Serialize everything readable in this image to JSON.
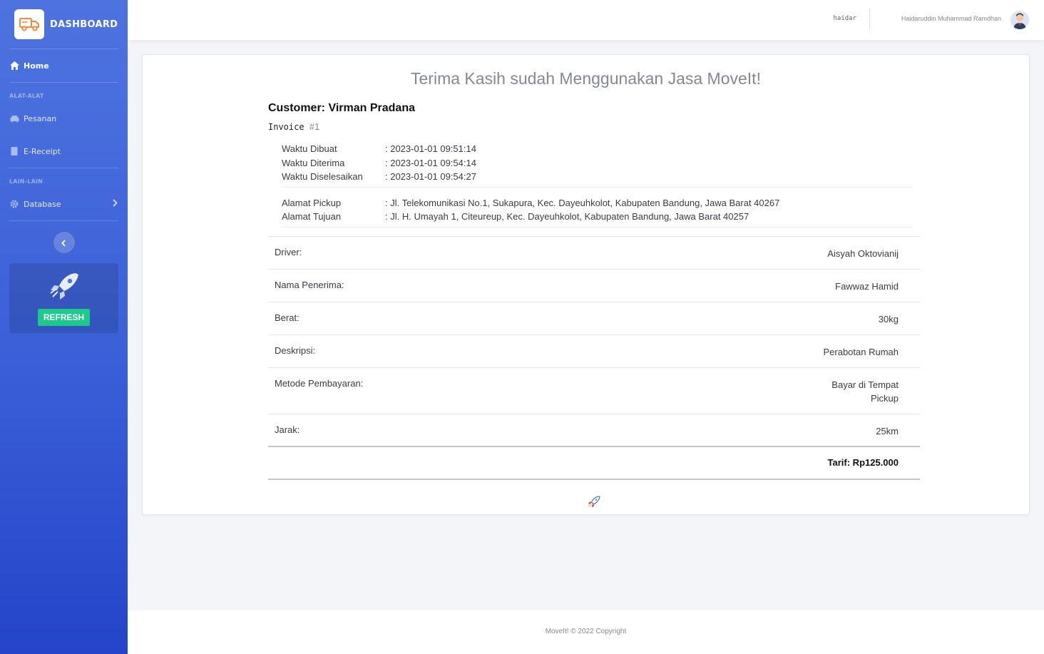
{
  "sidebar": {
    "brand": "DASHBOARD",
    "home": "Home",
    "heading_tools": "ALAT-ALAT",
    "pesanan": "Pesanan",
    "ereceipt": "E-Receipt",
    "heading_other": "LAIN-LAIN",
    "database": "Database",
    "refresh": "REFRESH"
  },
  "topbar": {
    "username": "haidar",
    "fullname": "Haidaruddin Muhammad Ramdhan"
  },
  "receipt": {
    "title": "Terima Kasih sudah Menggunakan Jasa MoveIt!",
    "customer": "Customer: Virman Pradana",
    "invoice_label": "Invoice",
    "invoice_num": "#1",
    "times": [
      {
        "label": "Waktu Dibuat",
        "value": ": 2023-01-01 09:51:14"
      },
      {
        "label": "Waktu Diterima",
        "value": ": 2023-01-01 09:54:14"
      },
      {
        "label": "Waktu Diselesaikan",
        "value": ": 2023-01-01 09:54:27"
      }
    ],
    "addresses": [
      {
        "label": "Alamat Pickup",
        "value": ": Jl. Telekomunikasi No.1, Sukapura, Kec. Dayeuhkolot, Kabupaten Bandung, Jawa Barat 40267"
      },
      {
        "label": "Alamat Tujuan",
        "value": ": Jl. H. Umayah 1, Citeureup, Kec. Dayeuhkolot, Kabupaten Bandung, Jawa Barat 40257"
      }
    ],
    "details": [
      {
        "label": "Driver:",
        "value": "Aisyah Oktovianij"
      },
      {
        "label": "Nama Penerima:",
        "value": "Fawwaz Hamid"
      },
      {
        "label": "Berat:",
        "value": "30kg"
      },
      {
        "label": "Deskripsi:",
        "value": "Perabotan Rumah"
      },
      {
        "label": "Metode Pembayaran:",
        "value_line1": "Bayar di Tempat",
        "value_line2": "Pickup"
      },
      {
        "label": "Jarak:",
        "value": "25km"
      }
    ],
    "total": "Tarif: Rp125.000"
  },
  "footer": "MoveIt! © 2022 Copyright",
  "colors": {
    "sidebar_top": "#4e73df",
    "sidebar_bottom": "#2544c9",
    "refresh": "#1cc88a",
    "logo_truck": "#f6893b"
  }
}
